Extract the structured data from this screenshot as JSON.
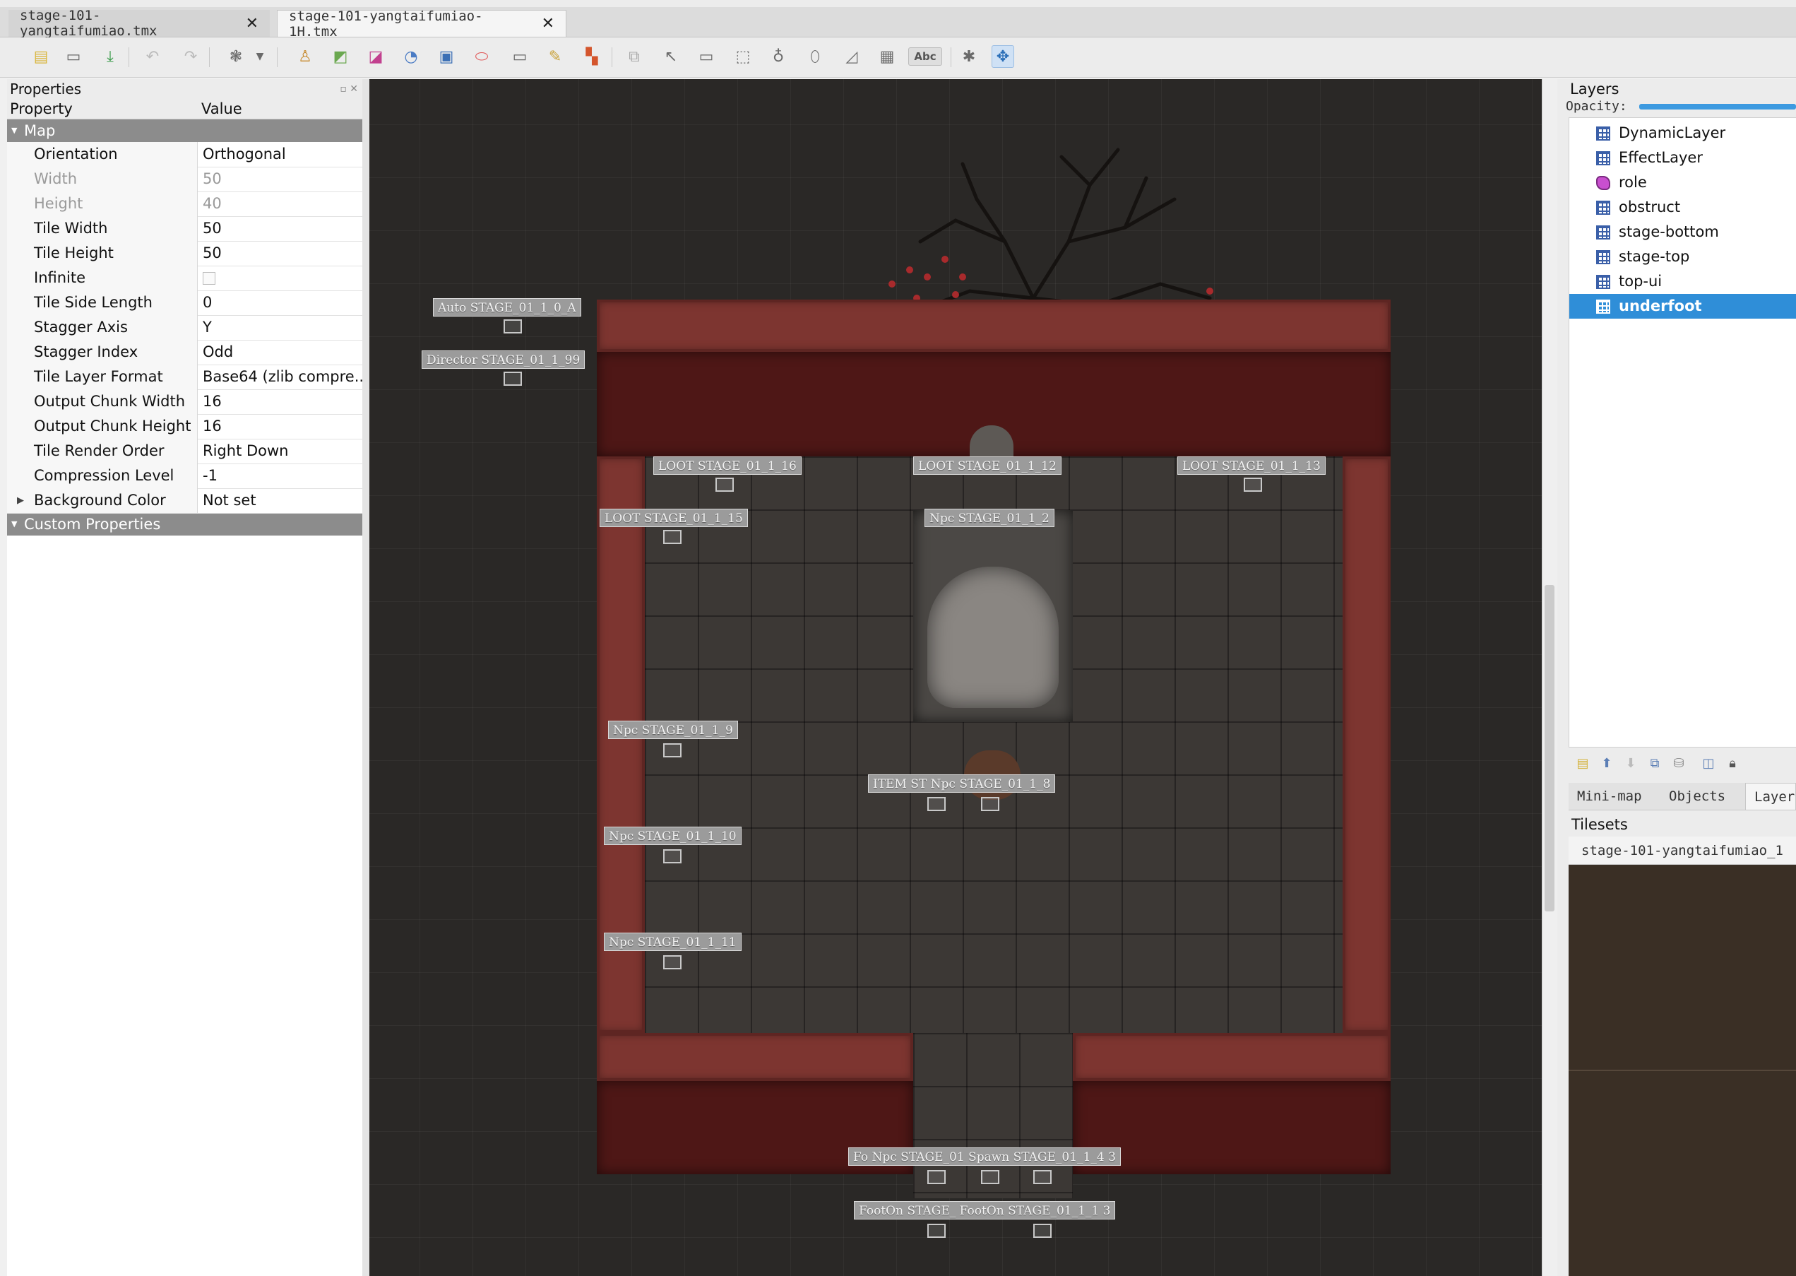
{
  "tabs": [
    {
      "label": "stage-101-yangtaifumiao.tmx",
      "active": false
    },
    {
      "label": "stage-101-yangtaifumiao-1H.tmx",
      "active": true
    }
  ],
  "toolbar": {
    "icons": [
      "new-map-icon",
      "open-icon",
      "save-icon",
      "undo-icon",
      "redo-icon",
      "stamp-brush-icon",
      "dropdown-icon",
      "terrain-brush-icon",
      "bucket-fill-icon",
      "shape-fill-icon",
      "magic-wand-icon",
      "select-tiles-icon",
      "eraser-icon",
      "rect-select-icon",
      "same-tile-icon",
      "random-mode-icon",
      "wangset-icon",
      "select-objects-icon",
      "edit-polygons-icon",
      "insert-rectangle-icon",
      "insert-point-icon",
      "insert-ellipse-icon",
      "insert-polygon-icon",
      "insert-tile-icon",
      "insert-template-icon",
      "insert-text-icon",
      "world-tool-icon",
      "move-icon"
    ],
    "text_tool_label": "Abc"
  },
  "properties": {
    "panel_title": "Properties",
    "col_property": "Property",
    "col_value": "Value",
    "group_map": "Map",
    "rows": [
      {
        "k": "Orientation",
        "v": "Orthogonal",
        "dim": false
      },
      {
        "k": "Width",
        "v": "50",
        "dim": true
      },
      {
        "k": "Height",
        "v": "40",
        "dim": true
      },
      {
        "k": "Tile Width",
        "v": "50",
        "dim": false
      },
      {
        "k": "Tile Height",
        "v": "50",
        "dim": false
      },
      {
        "k": "Infinite",
        "v": "",
        "dim": false,
        "checkbox": true
      },
      {
        "k": "Tile Side Length (Hex)",
        "v": "0",
        "dim": false
      },
      {
        "k": "Stagger Axis",
        "v": "Y",
        "dim": false
      },
      {
        "k": "Stagger Index",
        "v": "Odd",
        "dim": false
      },
      {
        "k": "Tile Layer Format",
        "v": "Base64 (zlib compre...",
        "dim": false
      },
      {
        "k": "Output Chunk Width",
        "v": "16",
        "dim": false
      },
      {
        "k": "Output Chunk Height",
        "v": "16",
        "dim": false
      },
      {
        "k": "Tile Render Order",
        "v": "Right Down",
        "dim": false
      },
      {
        "k": "Compression Level",
        "v": "-1",
        "dim": false
      },
      {
        "k": "Background Color",
        "v": "Not set",
        "dim": false,
        "expandable": true
      }
    ],
    "group_custom": "Custom Properties"
  },
  "map_objects": [
    {
      "label": "Auto STAGE_01_1_0_A"
    },
    {
      "label": "Director STAGE_01_1_99"
    },
    {
      "label": "LOOT STAGE_01_1_16"
    },
    {
      "label": "LOOT STAGE_01_1_12"
    },
    {
      "label": "LOOT STAGE_01_1_13"
    },
    {
      "label": "LOOT STAGE_01_1_15"
    },
    {
      "label": "Npc STAGE_01_1_2"
    },
    {
      "label": "Npc STAGE_01_1_9"
    },
    {
      "label": "ITEM ST Npc STAGE_01_1_8"
    },
    {
      "label": "Npc STAGE_01_1_10"
    },
    {
      "label": "Npc STAGE_01_1_11"
    },
    {
      "label": "Fo Npc STAGE_01 Spawn STAGE_01_1_4 3"
    },
    {
      "label": "FootOn STAGE_ FootOn STAGE_01_1_1 3"
    }
  ],
  "layers": {
    "title": "Layers",
    "opacity_label": "Opacity:",
    "opacity": 1.0,
    "items": [
      {
        "name": "DynamicLayer",
        "type": "tile",
        "selected": false
      },
      {
        "name": "EffectLayer",
        "type": "tile",
        "selected": false
      },
      {
        "name": "role",
        "type": "object",
        "selected": false
      },
      {
        "name": "obstruct",
        "type": "tile",
        "selected": false
      },
      {
        "name": "stage-bottom",
        "type": "tile",
        "selected": false
      },
      {
        "name": "stage-top",
        "type": "tile",
        "selected": false
      },
      {
        "name": "top-ui",
        "type": "tile",
        "selected": false
      },
      {
        "name": "underfoot",
        "type": "tile",
        "selected": true
      }
    ],
    "tools": [
      "new-layer-icon",
      "raise-layer-icon",
      "lower-layer-icon",
      "duplicate-layer-icon",
      "remove-layer-icon",
      "toggle-others-icon",
      "lock-icon"
    ]
  },
  "dock_tabs": [
    "Mini-map",
    "Objects",
    "Layer"
  ],
  "tilesets": {
    "title": "Tilesets",
    "active": "stage-101-yangtaifumiao_1"
  }
}
